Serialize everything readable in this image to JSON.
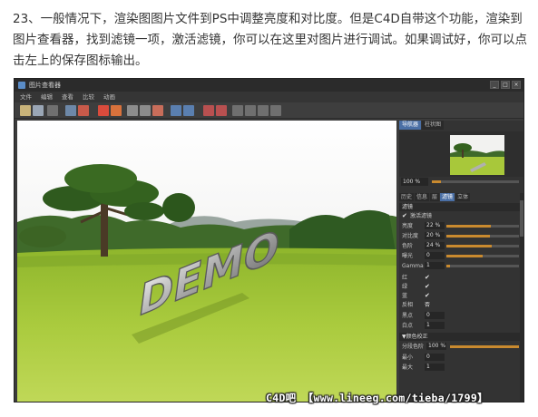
{
  "article": {
    "text": "23、一般情况下，渲染图图片文件到PS中调整亮度和对比度。但是C4D自带这个功能，渲染到图片查看器，找到滤镜一项，激活滤镜，你可以在这里对图片进行调试。如果调试好，你可以点击左上的保存图标输出。"
  },
  "window": {
    "title": "图片查看器",
    "controls": [
      "_",
      "□",
      "×"
    ]
  },
  "menu": [
    "文件",
    "编辑",
    "查看",
    "比较",
    "动画"
  ],
  "toolbar": {
    "icons": [
      "open-icon",
      "save-icon",
      "save-all-icon",
      "region-render-icon",
      "stop-icon",
      "zoom-icon",
      "ab-compare-icon",
      "filter-icon"
    ]
  },
  "viewport": {
    "render_text": "DEMO",
    "sky_color": "#f4f4f2",
    "grass_color": "#a8c83a"
  },
  "side": {
    "tabs": [
      "导航器",
      "柱状图"
    ],
    "active_tab": "导航器",
    "zoom_value": "100 %",
    "zoom_fraction": 0.1,
    "panel_tabs": [
      "历史",
      "信息",
      "层",
      "滤镜",
      "立体"
    ],
    "active_panel_tab": "滤镜",
    "filter_section": "滤镜",
    "activate_filter_label": "激活滤镜",
    "rows": [
      {
        "label": "亮度",
        "value": "22 %",
        "fraction": 0.61
      },
      {
        "label": "对比度",
        "value": "20 %",
        "fraction": 0.6
      },
      {
        "label": "色阶",
        "value": "24 %",
        "fraction": 0.62
      },
      {
        "label": "曝光",
        "value": "0",
        "fraction": 0.5
      },
      {
        "label": "Gamma",
        "value": "1",
        "fraction": 0.05
      }
    ],
    "channel_checks": [
      {
        "label": "红",
        "checked": true
      },
      {
        "label": "绿",
        "checked": true
      },
      {
        "label": "蓝",
        "checked": true
      }
    ],
    "invert_label": "反相",
    "invert_value": "否",
    "black_label": "黑点",
    "black_value": "0",
    "white_label": "白点",
    "white_value": "1",
    "curve_section": "▼颜色校正",
    "curve_row": {
      "label": "分段色阶",
      "value": "100 %",
      "fraction": 1.0
    },
    "min_label": "最小",
    "min_value": "0",
    "max_label": "最大",
    "max_value": "1"
  },
  "watermark": "C4D吧 【www.lineeg.com/tieba/1799】"
}
